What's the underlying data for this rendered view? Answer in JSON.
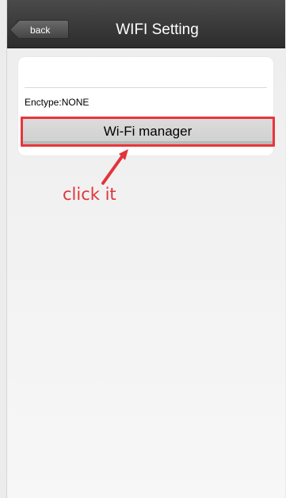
{
  "header": {
    "back_label": "back",
    "title": "WIFI Setting"
  },
  "card": {
    "enctype_text": "Enctype:NONE",
    "wifi_manager_label": "Wi-Fi manager"
  },
  "annotation": {
    "text": "click it",
    "color": "#e23439"
  },
  "colors": {
    "titlebar": "#333333",
    "background": "#ececec",
    "button_border": "#e8353b"
  }
}
